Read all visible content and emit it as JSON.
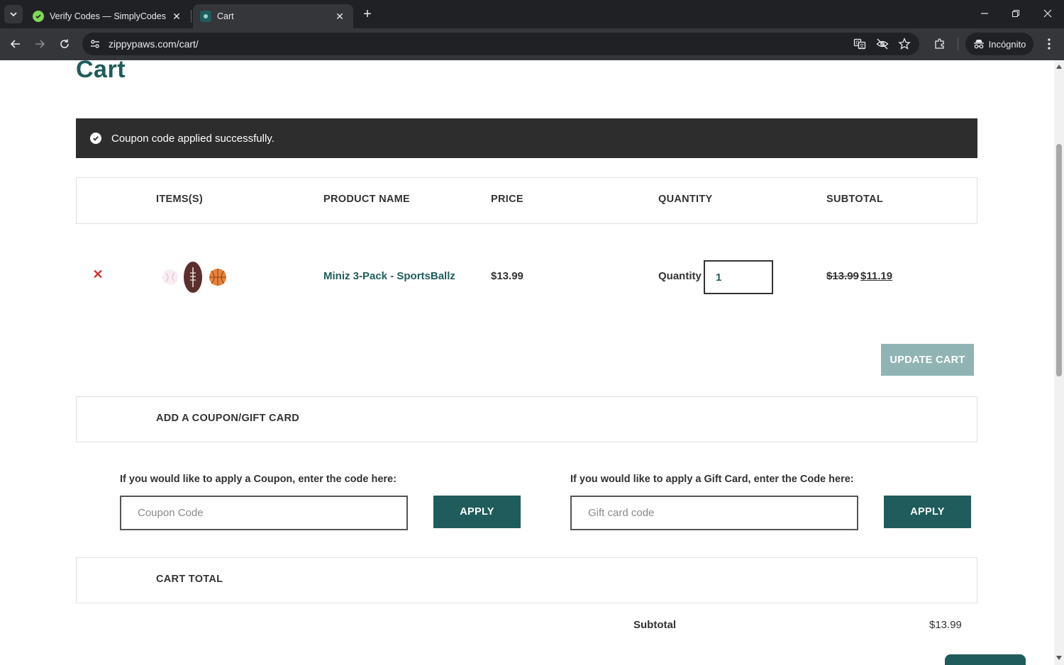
{
  "browser": {
    "tabs": [
      {
        "title": "Verify Codes — SimplyCodes",
        "active": false,
        "favicon_color": "#7ed957"
      },
      {
        "title": "Cart",
        "active": true,
        "favicon_color": "#1f5c5b"
      }
    ],
    "url": "zippypaws.com/cart/",
    "profile_label": "Incógnito"
  },
  "page": {
    "title": "Cart",
    "notice": "Coupon code applied successfully.",
    "cart_table": {
      "headers": [
        "ITEMS(S)",
        "PRODUCT NAME",
        "PRICE",
        "QUANTITY",
        "SUBTOTAL"
      ],
      "item": {
        "product_name": "Miniz 3-Pack - SportsBallz",
        "price": "$13.99",
        "quantity_label": "Quantity",
        "quantity": "1",
        "subtotal_original": "$13.99",
        "subtotal_discounted": "$11.19"
      }
    },
    "update_cart_label": "UPDATE CART",
    "coupon_section": {
      "title": "ADD A COUPON/GIFT CARD",
      "coupon_label": "If you would like to apply a Coupon, enter the code here:",
      "coupon_placeholder": "Coupon Code",
      "coupon_apply": "APPLY",
      "gift_label": "If you would like to apply a Gift Card, enter the Code here:",
      "gift_placeholder": "Gift card code",
      "gift_apply": "APPLY"
    },
    "cart_total": {
      "title": "CART TOTAL",
      "subtotal_label": "Subtotal",
      "subtotal_value": "$13.99"
    }
  },
  "colors": {
    "brand": "#1f5c5b",
    "notice_bg": "#2d2d2d",
    "update_button": "#8fb4b3",
    "remove": "#d32f2f"
  }
}
